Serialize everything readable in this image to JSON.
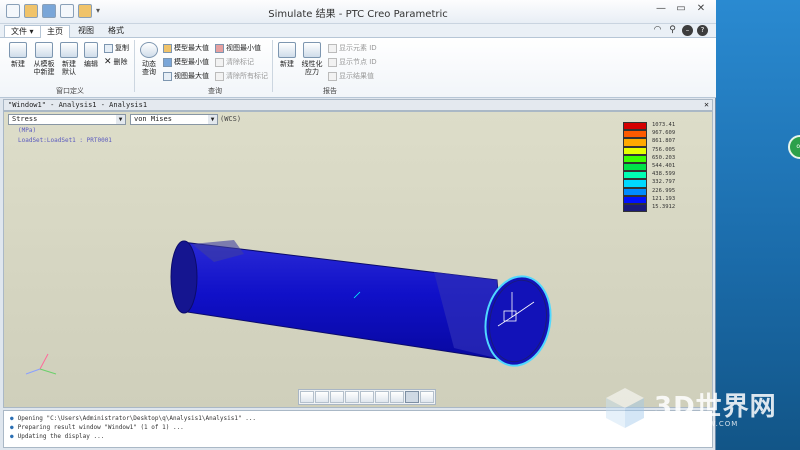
{
  "window": {
    "title": "Simulate 结果 - PTC Creo Parametric",
    "controls": [
      "—",
      "▭",
      "✕"
    ]
  },
  "tabs": [
    "文件 ▾",
    "主页",
    "视图",
    "格式"
  ],
  "ribbon": {
    "new": "新建",
    "from_template": [
      "从模板",
      "中新建"
    ],
    "new_default": [
      "新建",
      "默认"
    ],
    "edit": "编辑",
    "copy": "复制",
    "delete": "删除",
    "dynamic_query": [
      "动态",
      "查询"
    ],
    "model_max": "模型最大值",
    "model_min": "模型最小值",
    "view_max": "视图最大值",
    "view_min": "视图最小值",
    "remove_marks": "清除标记",
    "remove_all_marks": "清除所有标记",
    "new2": "新建",
    "linearized_stress": [
      "线性化",
      "应力"
    ],
    "show_element_id": "显示元素 ID",
    "show_node_id": "显示节点 ID",
    "show_result_value": "显示结果值",
    "group_window_def": "窗口定义",
    "group_query": "查询",
    "group_report": "报告"
  },
  "graphics": {
    "header": "\"Window1\" - Analysis1 - Analysis1",
    "quantity": "Stress",
    "component": "von Mises",
    "csys": "(WCS)",
    "units": "(MPa)",
    "loadset": "LoadSet:LoadSet1 : PRT0001"
  },
  "legend": {
    "values": [
      "1073.41",
      "967.609",
      "861.807",
      "756.005",
      "650.203",
      "544.401",
      "438.599",
      "332.797",
      "226.995",
      "121.193",
      "15.3912"
    ],
    "colors": [
      "#d40000",
      "#ff5a00",
      "#ffa800",
      "#e8ff00",
      "#3cff00",
      "#00e24a",
      "#00ffb4",
      "#00d8ff",
      "#008cff",
      "#0010ff",
      "#1a1a7a"
    ]
  },
  "messages": [
    "Opening \"C:\\Users\\Administrator\\Desktop\\q\\Analysis1\\Analysis1\" ...",
    "Preparing result window \"Window1\" (1 of 1) ...",
    "Updating the display ..."
  ],
  "watermark": {
    "text": "3D世界网",
    "url": "WWW.3DSJW.COM"
  },
  "desktop_badge": "ok"
}
